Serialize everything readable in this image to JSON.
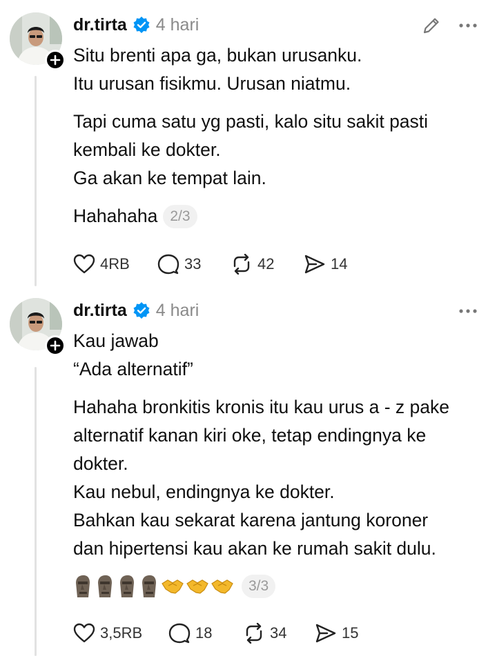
{
  "posts": [
    {
      "username": "dr.tirta",
      "time": "4 hari",
      "paragraphs": [
        [
          "Situ brenti apa ga, bukan urusanku.",
          "Itu urusan fisikmu. Urusan niatmu."
        ],
        [
          "Tapi cuma satu yg pasti, kalo situ sakit pasti",
          "kembali ke dokter.",
          "Ga akan ke tempat lain."
        ]
      ],
      "last_line": "Hahahaha",
      "counter": "2/3",
      "likes": "4RB",
      "replies": "33",
      "reposts": "42",
      "shares": "14"
    },
    {
      "username": "dr.tirta",
      "time": "4 hari",
      "paragraphs": [
        [
          "Kau jawab",
          "“Ada alternatif”"
        ],
        [
          "Hahaha bronkitis kronis itu kau urus a - z pake",
          "alternatif kanan kiri oke, tetap endingnya ke",
          "dokter.",
          "Kau nebul, endingnya ke dokter.",
          "Bahkan kau sekarat karena jantung koroner",
          "dan hipertensi kau akan ke rumah sakit dulu."
        ]
      ],
      "emoji": [
        "moai-icon",
        "moai-icon",
        "moai-icon",
        "moai-icon",
        "handshake-icon",
        "handshake-icon",
        "handshake-icon"
      ],
      "counter": "3/3",
      "likes": "3,5RB",
      "replies": "18",
      "reposts": "34",
      "shares": "15"
    }
  ],
  "colors": {
    "verified": "#0095f6",
    "muted": "#8a8a8a",
    "text": "#101010"
  }
}
